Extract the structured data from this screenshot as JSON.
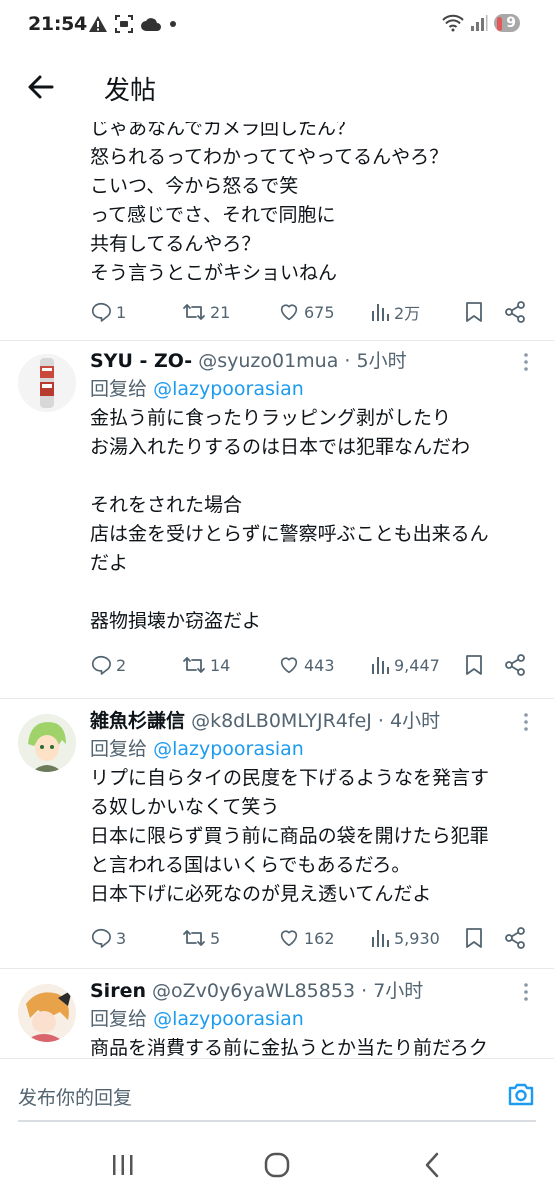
{
  "status_bar": {
    "time": "21:54",
    "battery": "9"
  },
  "header": {
    "title": "发帖"
  },
  "first_post": {
    "text": "じゃあなんでカメラ回したん？\n怒られるってわかっててやってるんやろ？\nこいつ、今から怒るで笑\nって感じでさ、それで同胞に\n共有してるんやろ？\nそう言うとこがキショいねん",
    "replies": "1",
    "retweets": "21",
    "likes": "675",
    "views": "2万"
  },
  "replies": [
    {
      "display_name": "SYU - ZO-",
      "handle": "@syuzo01mua",
      "time": "5小时",
      "reply_label": "回复给",
      "mention": "@lazypoorasian",
      "text": "金払う前に食ったりラッピング剥がしたり\nお湯入れたりするのは日本では犯罪なんだわ\n\nそれをされた場合\n店は金を受けとらずに警察呼ぶことも出来るん\nだよ\n\n器物損壊か窃盗だよ",
      "replies": "2",
      "retweets": "14",
      "likes": "443",
      "views": "9,447"
    },
    {
      "display_name": "雑魚杉謙信",
      "handle": "@k8dLB0MLYJR4feJ",
      "time": "4小时",
      "reply_label": "回复给",
      "mention": "@lazypoorasian",
      "text": "リプに自らタイの民度を下げるようなを発言す\nる奴しかいなくて笑う\n日本に限らず買う前に商品の袋を開けたら犯罪\nと言われる国はいくらでもあるだろ。\n日本下げに必死なのが見え透いてんだよ",
      "replies": "3",
      "retweets": "5",
      "likes": "162",
      "views": "5,930"
    },
    {
      "display_name": "Siren",
      "handle": "@oZv0y6yaWL85853",
      "time": "7小时",
      "reply_label": "回复给",
      "mention": "@lazypoorasian",
      "text": "商品を消費する前に金払うとか当たり前だろク"
    }
  ],
  "composer": {
    "placeholder": "发布你的回复"
  },
  "colors": {
    "accent": "#1d9bf0",
    "secondary_text": "#536471",
    "primary_text": "#0f1419"
  }
}
